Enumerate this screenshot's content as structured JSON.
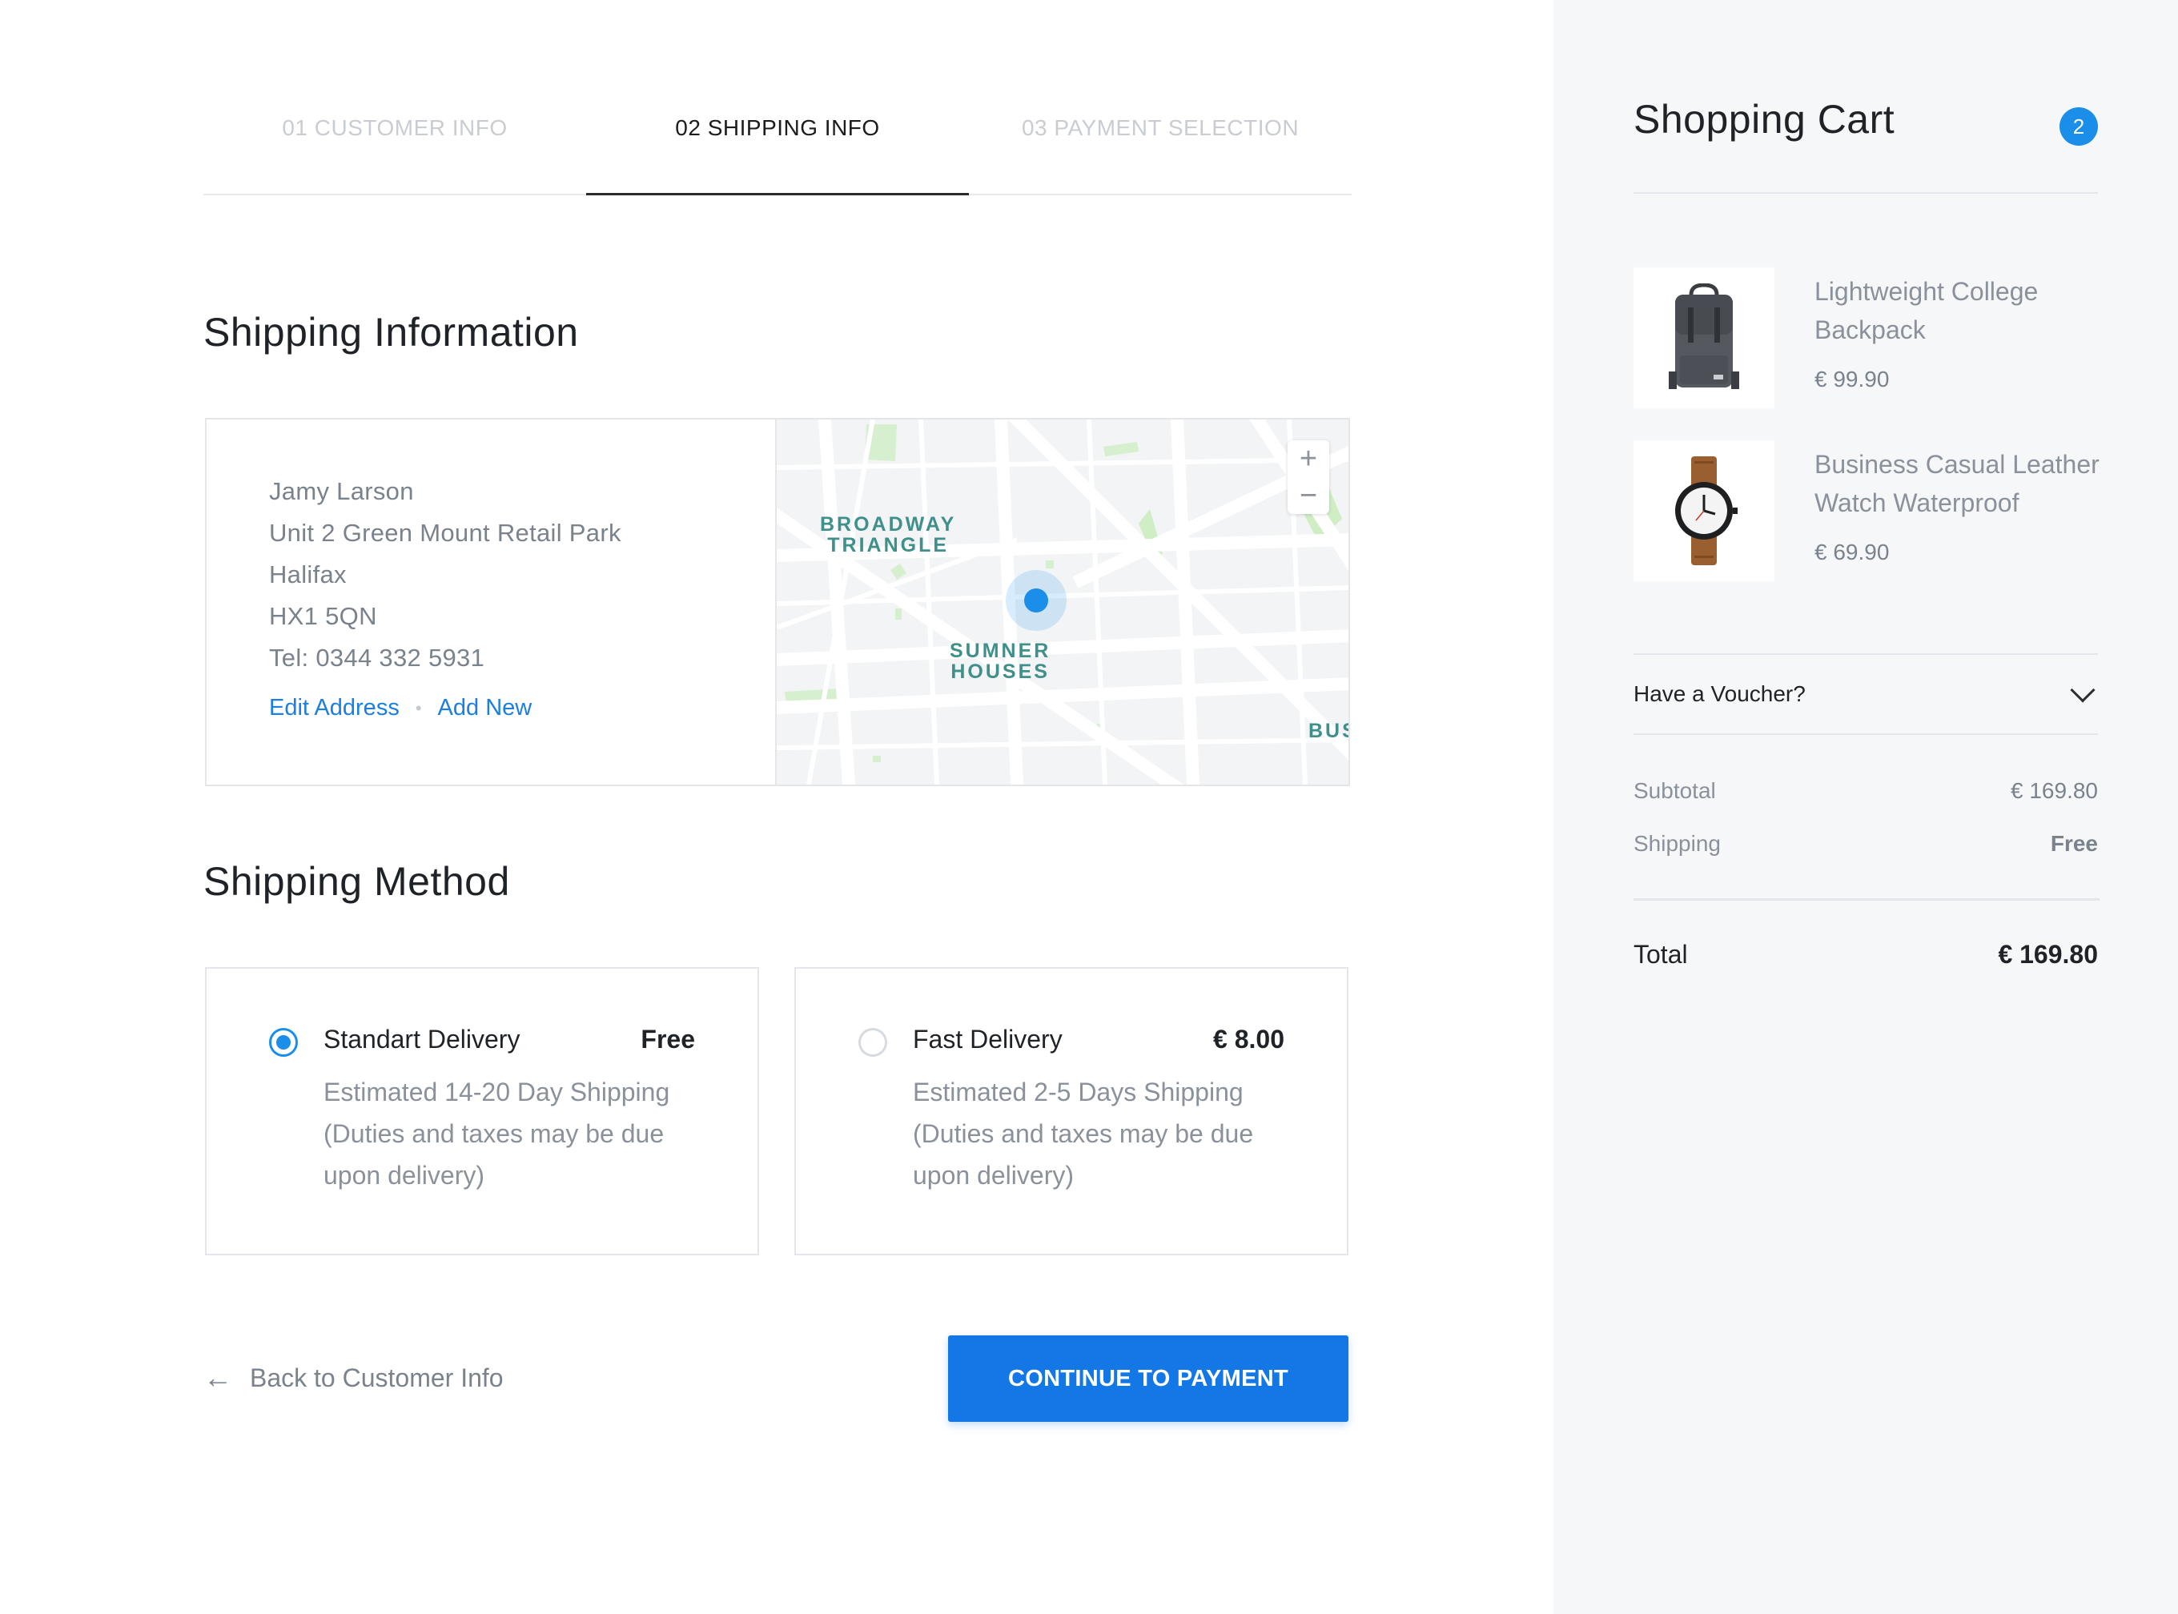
{
  "steps": [
    {
      "label": "01 CUSTOMER INFO",
      "active": false
    },
    {
      "label": "02 SHIPPING INFO",
      "active": true
    },
    {
      "label": "03 PAYMENT SELECTION",
      "active": false
    }
  ],
  "shipping_info": {
    "title": "Shipping Information",
    "address": {
      "name": "Jamy Larson",
      "line1": "Unit 2 Green Mount Retail Park",
      "city": "Halifax",
      "postcode": "HX1 5QN",
      "phone": "Tel:  0344 332 5931"
    },
    "edit_label": "Edit Address",
    "separator": "•",
    "add_label": "Add New",
    "map": {
      "label1_line1": "BROADWAY",
      "label1_line2": "TRIANGLE",
      "label2_line1": "SUMNER",
      "label2_line2": "HOUSES",
      "label3": "BUS",
      "zoom_in": "+",
      "zoom_out": "−"
    }
  },
  "shipping_method": {
    "title": "Shipping Method",
    "options": [
      {
        "name": "Standart Delivery",
        "price": "Free",
        "desc": "Estimated 14-20 Day Shipping (Duties and taxes may be due upon delivery)",
        "selected": true
      },
      {
        "name": "Fast Delivery",
        "price": "€ 8.00",
        "desc": "Estimated 2-5 Days Shipping (Duties and taxes may be due upon delivery)",
        "selected": false
      }
    ]
  },
  "footer": {
    "back_arrow": "←",
    "back_label": "Back to Customer Info",
    "continue_label": "CONTINUE TO PAYMENT"
  },
  "cart": {
    "title": "Shopping Cart",
    "count": "2",
    "items": [
      {
        "name": "Lightweight College Backpack",
        "price": "€ 99.90",
        "icon": "backpack-image"
      },
      {
        "name": "Business Casual Leather Watch Waterproof",
        "price": "€ 69.90",
        "icon": "watch-image"
      }
    ],
    "voucher_label": "Have a Voucher?",
    "subtotal_label": "Subtotal",
    "subtotal_value": "€ 169.80",
    "shipping_label": "Shipping",
    "shipping_value": "Free",
    "total_label": "Total",
    "total_value": "€ 169.80"
  },
  "colors": {
    "accent": "#1477e6",
    "link": "#1a7fe0",
    "sidebar_bg": "#f6f7f9"
  }
}
